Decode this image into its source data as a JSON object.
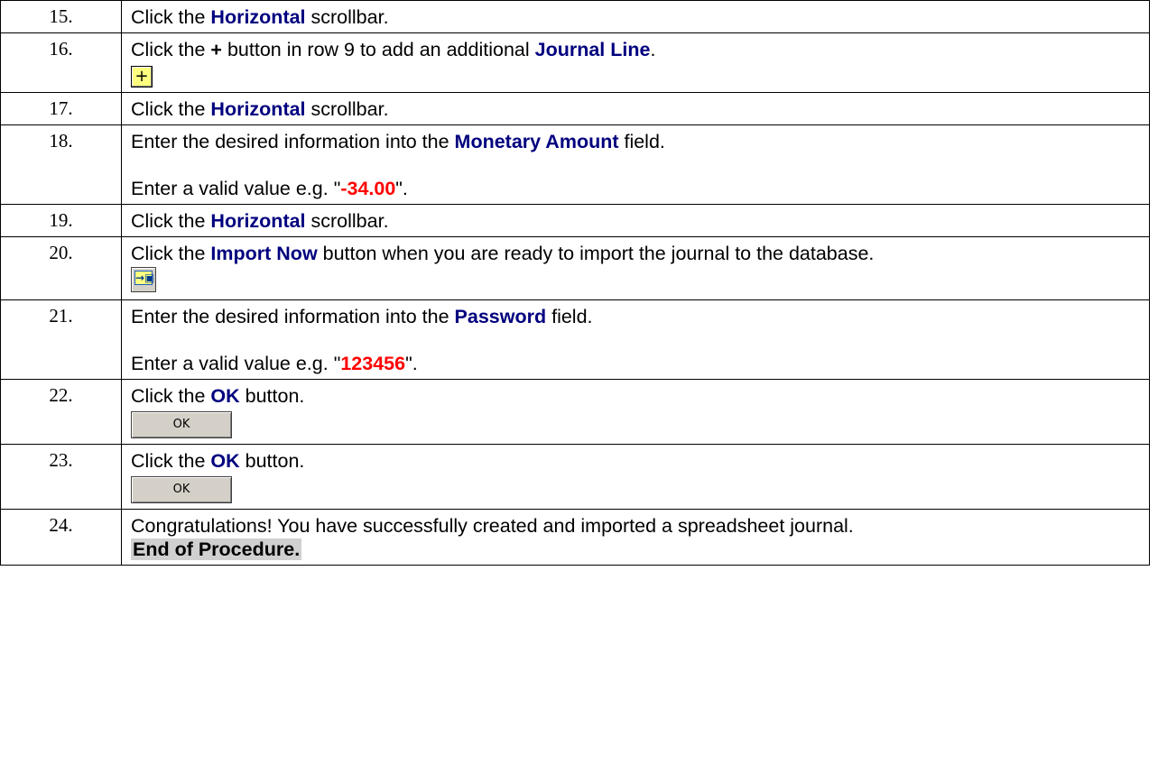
{
  "steps": [
    {
      "num": "15.",
      "pre": "Click the ",
      "kw": "Horizontal",
      "post": " scrollbar."
    },
    {
      "num": "16.",
      "pre": "Click the ",
      "plus": "+",
      "mid": " button in row 9 to add an additional ",
      "kw": "Journal Line",
      "post": ".",
      "icon_label": "+"
    },
    {
      "num": "17.",
      "pre": "Click the ",
      "kw": "Horizontal",
      "post": " scrollbar."
    },
    {
      "num": "18.",
      "pre": "Enter the desired information into the ",
      "kw": "Monetary Amount",
      "post": " field.",
      "hint_pre": "Enter a valid value e.g. \"",
      "hint_val": "-34.00",
      "hint_post": "\"."
    },
    {
      "num": "19.",
      "pre": "Click the ",
      "kw": "Horizontal",
      "post": " scrollbar."
    },
    {
      "num": "20.",
      "pre": "Click the ",
      "kw": "Import Now",
      "post": " button when you are ready to import the journal to the database.",
      "icon_label": "→▣"
    },
    {
      "num": "21.",
      "pre": "Enter the desired information into the ",
      "kw": "Password",
      "post": " field.",
      "hint_pre": "Enter a valid value e.g. \"",
      "hint_val": "123456",
      "hint_post": "\"."
    },
    {
      "num": "22.",
      "pre": "Click the ",
      "kw": "OK",
      "post": " button.",
      "icon_label": "OK"
    },
    {
      "num": "23.",
      "pre": "Click the ",
      "kw": "OK",
      "post": " button.",
      "icon_label": "OK"
    },
    {
      "num": "24.",
      "text": "Congratulations! You have successfully created and imported a spreadsheet journal.",
      "end": "End of Procedure."
    }
  ],
  "colors": {
    "keyword": "#00007f",
    "value": "#ff0000",
    "end_highlight": "#d0d0d0",
    "button_face": "#ffff80"
  },
  "icons": {
    "add_row": "plus-button-icon",
    "import": "import-now-icon",
    "ok": "ok-button-image"
  }
}
